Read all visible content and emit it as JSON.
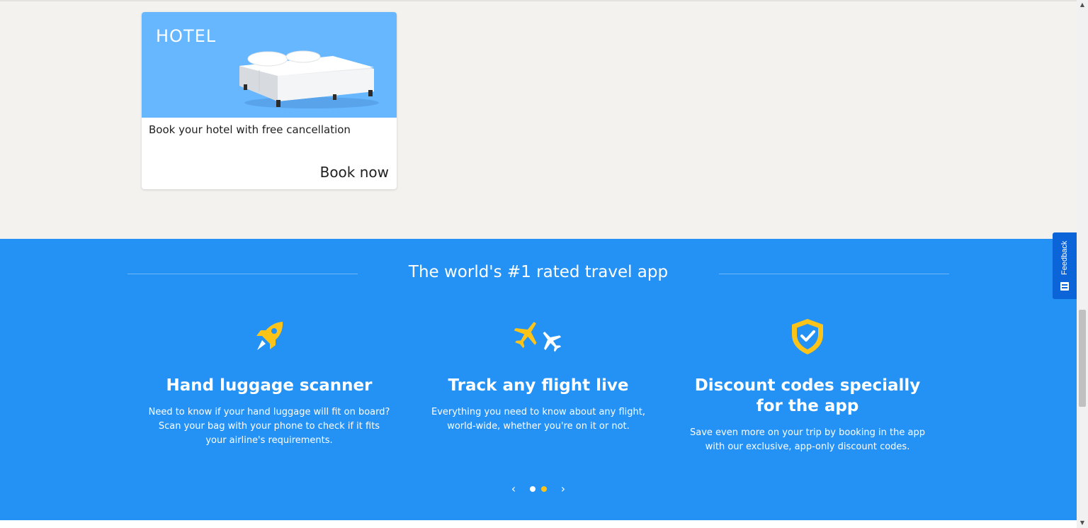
{
  "hotel_card": {
    "tag": "HOTEL",
    "text": "Book your hotel with free cancellation",
    "cta": "Book now",
    "image_bg": "#66b7ff"
  },
  "app_section": {
    "title": "The world's #1 rated travel app",
    "background": "#2491f5",
    "features": [
      {
        "icon": "rocket-icon",
        "title": "Hand luggage scanner",
        "description": "Need to know if your hand luggage will fit on board? Scan your bag with your phone to check if it fits your airline's requirements."
      },
      {
        "icon": "planes-icon",
        "title": "Track any flight live",
        "description": "Everything you need to know about any flight, world-wide, whether you're on it or not."
      },
      {
        "icon": "shield-check-icon",
        "title": "Discount codes specially for the app",
        "description": "Save even more on your trip by booking in the app with our exclusive, app-only discount codes."
      }
    ],
    "carousel": {
      "prev": "‹",
      "next": "›",
      "dot_count": 2,
      "active_dot": 2,
      "active_color": "#fcc419"
    }
  },
  "feedback_tab": {
    "label": "Feedback",
    "color": "#0b65d8"
  }
}
